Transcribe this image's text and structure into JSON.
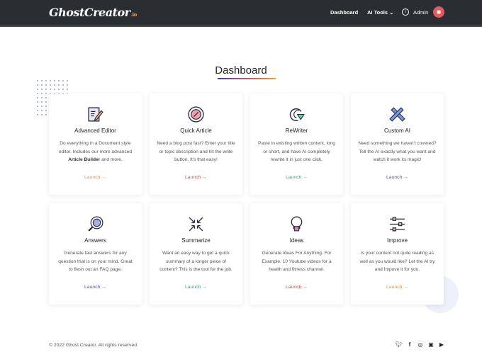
{
  "header": {
    "logo": "GhostCreator",
    "logo_suffix": ".io",
    "nav": {
      "dashboard": "Dashboard",
      "ai_tools": "AI Tools ⌄",
      "admin": "Admin"
    }
  },
  "page": {
    "title": "Dashboard"
  },
  "cards": [
    {
      "title": "Advanced Editor",
      "desc_pre": "Do everything in a Document style editor. Includes our more advanced ",
      "desc_bold": "Article Builder",
      "desc_post": " and more.",
      "launch": "Launch →",
      "color": "#e8914a"
    },
    {
      "title": "Quick Article",
      "desc": "Need a blog post fast? Enter your title or topic description and hit the write button. It's that easy!",
      "launch": "Launch →",
      "color": "#d54a4f"
    },
    {
      "title": "ReWriter",
      "desc": "Paste in existing written content, long or short, and have AI completely rewrite it in just one click.",
      "launch": "Launch →",
      "color": "#3aa57a"
    },
    {
      "title": "Custom AI",
      "desc": "Need something we haven't covered? Tell the AI exactly what you want and watch it work its magic!",
      "launch": "Launch →",
      "color": "#4552a8"
    },
    {
      "title": "Answers",
      "desc": "Generate fast answers for any question that is on your mind. Great to flesh out an FAQ page.",
      "launch": "Launch →",
      "color": "#4552a8"
    },
    {
      "title": "Summarize",
      "desc": "Want an easy way to get a quick summary of a longer piece of content? This is the tool for the job.",
      "launch": "Launch →",
      "color": "#3aa57a"
    },
    {
      "title": "Ideas",
      "desc": "Generate Ideas For Anything. For Example: 10 Youtube videos for a health and fitness channel.",
      "launch": "Launch →",
      "color": "#d54a4f"
    },
    {
      "title": "Improve",
      "desc": "Is your content not quite reading as well as you would like? Let the AI try and Impove it for you.",
      "launch": "Launch →",
      "color": "#e8914a"
    }
  ],
  "footer": {
    "copyright": "© 2022 Ghost Creator. All rights reserved."
  }
}
